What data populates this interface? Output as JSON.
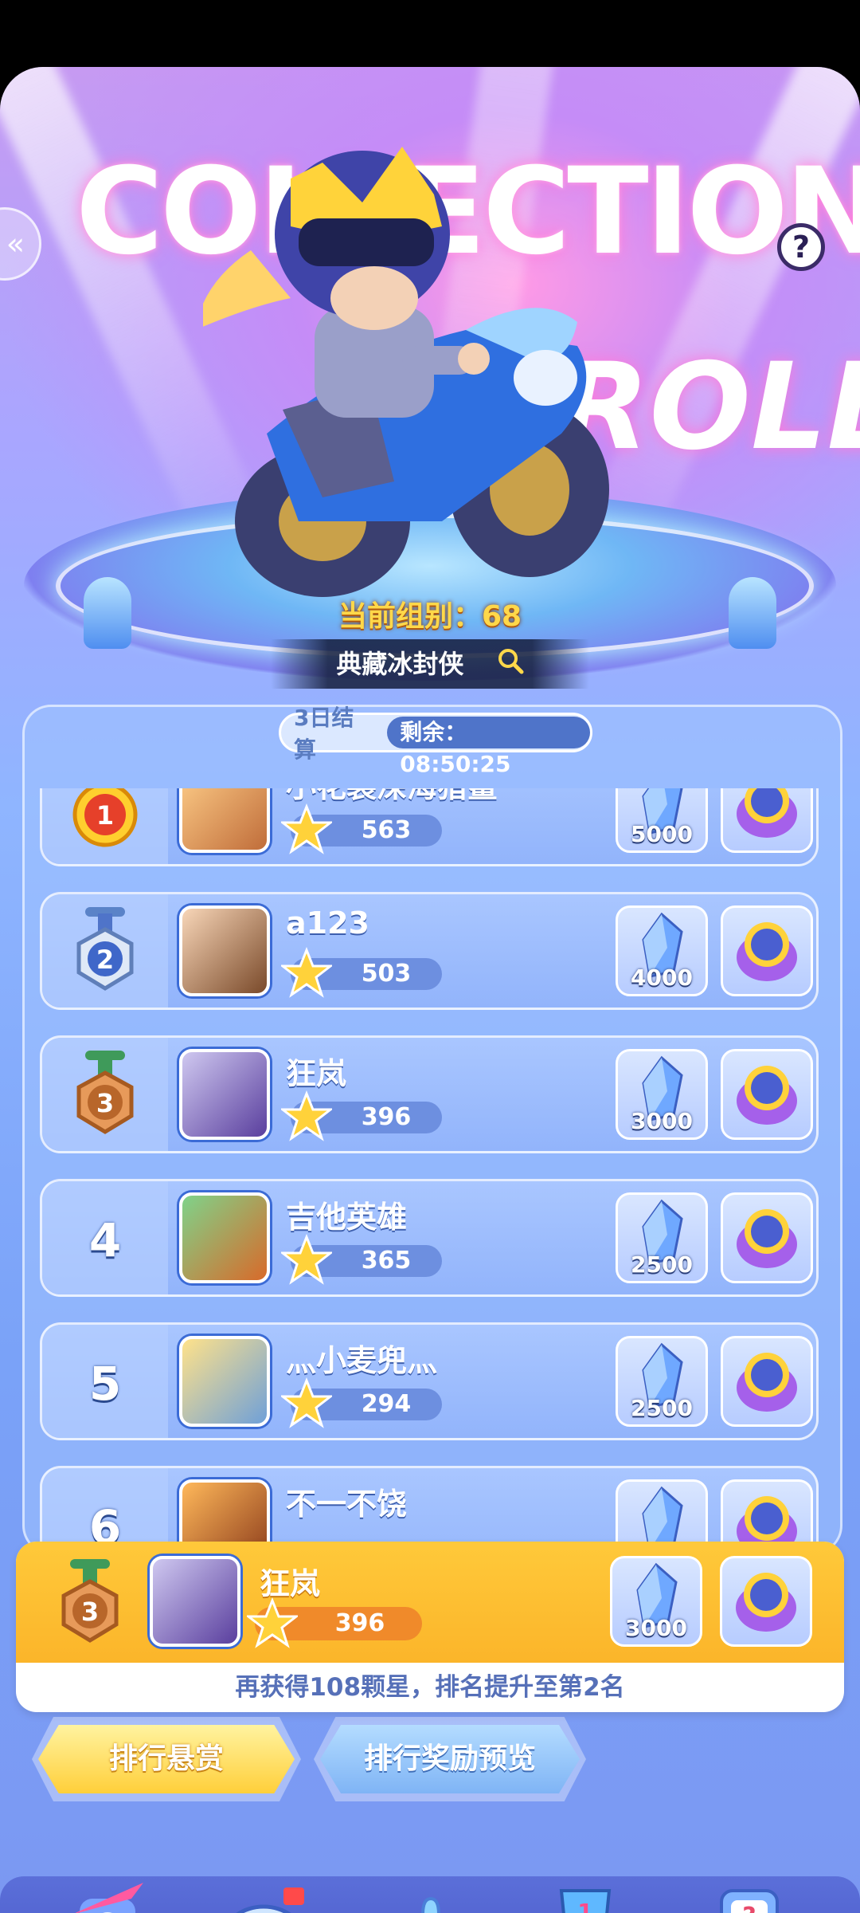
{
  "hero": {
    "title_line1": "COLLECTION",
    "title_line2": "ROLL",
    "group_label": "当前组别：68",
    "search_label": "典藏冰封侠",
    "help_symbol": "?",
    "side_tab_symbol": "«",
    "settle_label": "3日结算",
    "remain_label": "剩余：08:50:25"
  },
  "rankings": [
    {
      "rank": "1",
      "name": "小花装深海猎鲨",
      "score": "563",
      "crystal": "5000",
      "medal": "gold"
    },
    {
      "rank": "2",
      "name": "a123",
      "score": "503",
      "crystal": "4000",
      "medal": "silver"
    },
    {
      "rank": "3",
      "name": "狂岚",
      "score": "396",
      "crystal": "3000",
      "medal": "bronze"
    },
    {
      "rank": "4",
      "name": "吉他英雄",
      "score": "365",
      "crystal": "2500",
      "medal": ""
    },
    {
      "rank": "5",
      "name": "灬小麦兜灬",
      "score": "294",
      "crystal": "2500",
      "medal": ""
    },
    {
      "rank": "6",
      "name": "不一不饶",
      "score": "",
      "crystal": "",
      "medal": ""
    }
  ],
  "my_rank": {
    "rank": "3",
    "name": "狂岚",
    "score": "396",
    "crystal": "3000",
    "hint": "再获得108颗星，排名提升至第2名"
  },
  "tabs": {
    "reward": "排行悬赏",
    "preview": "排行奖励预览"
  },
  "colors": {
    "gold": "#ffc93a",
    "accent_blue": "#4f74c9",
    "row_blue": "#a9c6ff"
  },
  "bottom_nav_icons": [
    "arrow-target-icon",
    "whistle-icon",
    "puzzle-icon",
    "trophy-icon",
    "mystery-machine-icon"
  ]
}
